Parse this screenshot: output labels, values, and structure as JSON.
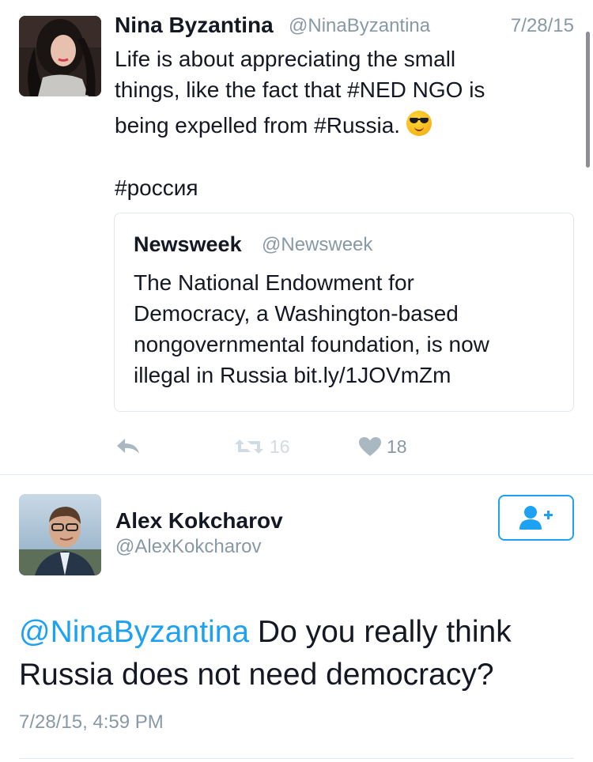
{
  "tweet": {
    "author_name": "Nina Byzantina",
    "author_handle": "@NinaByzantina",
    "date": "7/28/15",
    "text_line1": "Life is about appreciating the small",
    "text_line2": "things, like the fact that #NED NGO is",
    "text_line3": "being expelled from #Russia.",
    "emoji": "smiling-face-with-sunglasses",
    "hashtag_line": "#россия",
    "quoted": {
      "author_name": "Newsweek",
      "author_handle": "@Newsweek",
      "text_line1": "The National Endowment for",
      "text_line2": "Democracy, a Washington-based",
      "text_line3": "nongovernmental foundation, is now",
      "text_line4": "illegal in Russia bit.ly/1JOVmZm"
    },
    "actions": {
      "reply_icon": "reply-icon",
      "retweet_count": "16",
      "like_count": "18"
    }
  },
  "reply": {
    "author_name": "Alex Kokcharov",
    "author_handle": "@AlexKokcharov",
    "follow_icon": "add-user-icon",
    "mention": "@NinaByzantina",
    "text_after_mention": " Do you really think",
    "text_line2": "Russia does not need democracy?",
    "timestamp": "7/28/15, 4:59 PM"
  },
  "colors": {
    "link_blue": "#1da1f2",
    "secondary_gray": "#8899a6",
    "text_dark": "#141823",
    "border": "#e1e8ed"
  }
}
